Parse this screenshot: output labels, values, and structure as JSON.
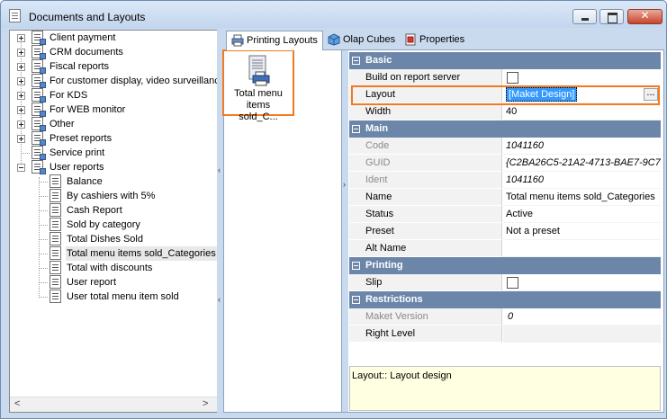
{
  "window": {
    "title": "Documents and Layouts"
  },
  "tree": {
    "items": [
      {
        "label": "Client payment",
        "level": 0,
        "expandable": true
      },
      {
        "label": "CRM documents",
        "level": 0,
        "expandable": true
      },
      {
        "label": "Fiscal reports",
        "level": 0,
        "expandable": true
      },
      {
        "label": "For customer display, video surveillance",
        "level": 0,
        "expandable": true
      },
      {
        "label": "For KDS",
        "level": 0,
        "expandable": true
      },
      {
        "label": "For WEB monitor",
        "level": 0,
        "expandable": true
      },
      {
        "label": "Other",
        "level": 0,
        "expandable": true
      },
      {
        "label": "Preset reports",
        "level": 0,
        "expandable": true
      },
      {
        "label": "Service print",
        "level": 0,
        "expandable": false
      },
      {
        "label": "User reports",
        "level": 0,
        "expanded": true
      },
      {
        "label": "Balance",
        "level": 1
      },
      {
        "label": "By cashiers with 5%",
        "level": 1
      },
      {
        "label": "Cash Report",
        "level": 1
      },
      {
        "label": "Sold by category",
        "level": 1
      },
      {
        "label": "Total Dishes Sold",
        "level": 1
      },
      {
        "label": "Total menu items sold_Categories",
        "level": 1,
        "selected": true
      },
      {
        "label": "Total with discounts",
        "level": 1
      },
      {
        "label": "User report",
        "level": 1
      },
      {
        "label": "User total menu item sold",
        "level": 1
      }
    ]
  },
  "tabs": [
    {
      "label": "Printing Layouts",
      "active": true,
      "icon": "printer-icon"
    },
    {
      "label": "Olap Cubes",
      "active": false,
      "icon": "cube-icon"
    },
    {
      "label": "Properties",
      "active": false,
      "icon": "properties-icon"
    }
  ],
  "layout_item": {
    "caption": "Total menu items sold_C...",
    "icon": "printer-icon"
  },
  "properties": {
    "basic": {
      "label": "Basic",
      "build_on_server": {
        "name": "Build on report server",
        "checked": false
      },
      "layout": {
        "name": "Layout",
        "value": "[Maket Design]"
      },
      "width": {
        "name": "Width",
        "value": "40"
      }
    },
    "main": {
      "label": "Main",
      "code": {
        "name": "Code",
        "value": "1041160"
      },
      "guid": {
        "name": "GUID",
        "value": "{C2BA26C5-21A2-4713-BAE7-9C7"
      },
      "ident": {
        "name": "Ident",
        "value": "1041160"
      },
      "name": {
        "name": "Name",
        "value": "Total menu items sold_Categories"
      },
      "status": {
        "name": "Status",
        "value": "Active"
      },
      "preset": {
        "name": "Preset",
        "value": "Not a preset"
      },
      "alt_name": {
        "name": "Alt Name",
        "value": ""
      }
    },
    "printing": {
      "label": "Printing",
      "slip": {
        "name": "Slip",
        "checked": false
      }
    },
    "restrictions": {
      "label": "Restrictions",
      "maket_version": {
        "name": "Maket Version",
        "value": "0"
      },
      "right_level": {
        "name": "Right Level",
        "value": ""
      }
    }
  },
  "description": "Layout:: Layout design",
  "colors": {
    "accent_highlight": "#f27a20",
    "category_header": "#6c86aa",
    "selection": "#3399ff"
  }
}
